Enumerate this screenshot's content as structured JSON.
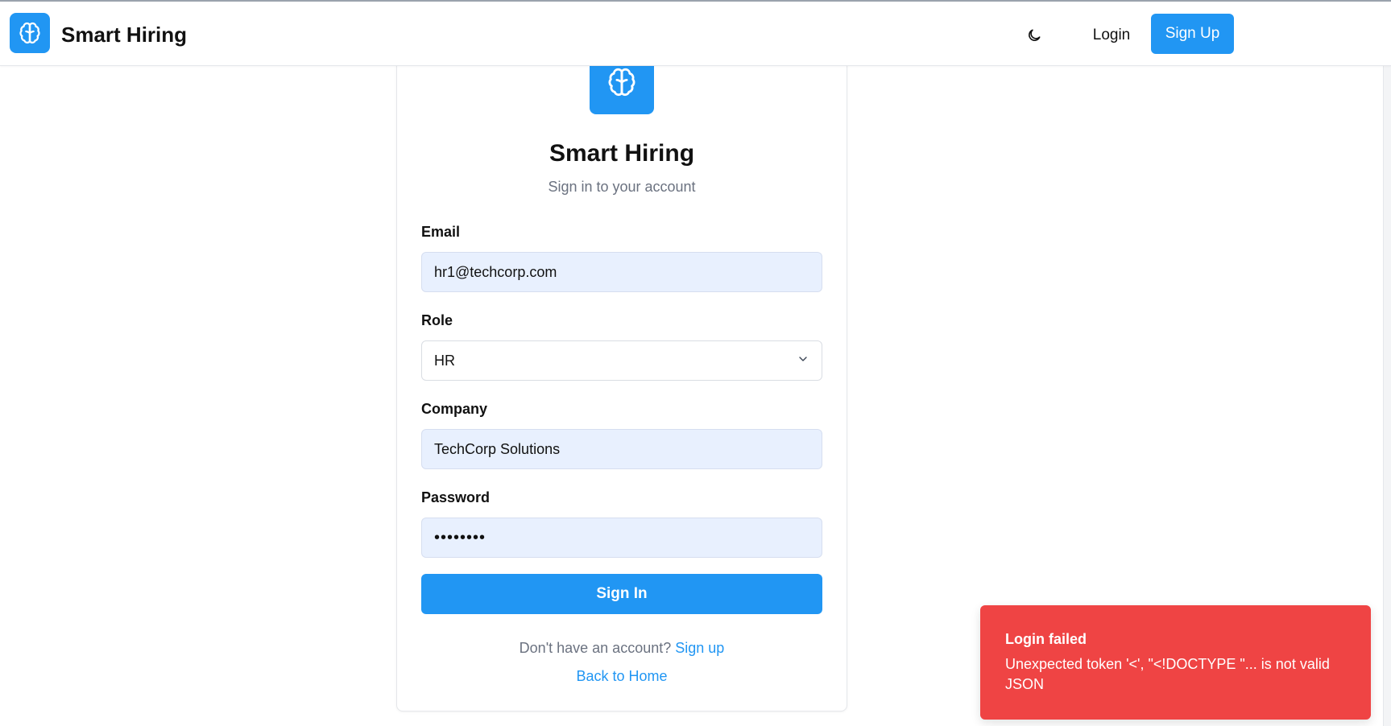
{
  "header": {
    "brand_title": "Smart Hiring",
    "theme_toggle_icon": "moon-icon",
    "login_label": "Login",
    "signup_label": "Sign Up"
  },
  "card": {
    "logo_icon": "brain-icon",
    "title": "Smart Hiring",
    "subtitle": "Sign in to your account",
    "email": {
      "label": "Email",
      "value": "hr1@techcorp.com"
    },
    "role": {
      "label": "Role",
      "value": "HR"
    },
    "company": {
      "label": "Company",
      "value": "TechCorp Solutions"
    },
    "password": {
      "label": "Password",
      "value": "••••••••"
    },
    "sign_in_label": "Sign In",
    "no_account_text": "Don't have an account?",
    "sign_up_link": "Sign up",
    "back_home_link": "Back to Home"
  },
  "toast": {
    "title": "Login failed",
    "message": "Unexpected token '<', \"<!DOCTYPE \"... is not valid JSON"
  },
  "colors": {
    "accent": "#2196f3",
    "error": "#ef4444",
    "input_filled": "#e8f0fe"
  }
}
